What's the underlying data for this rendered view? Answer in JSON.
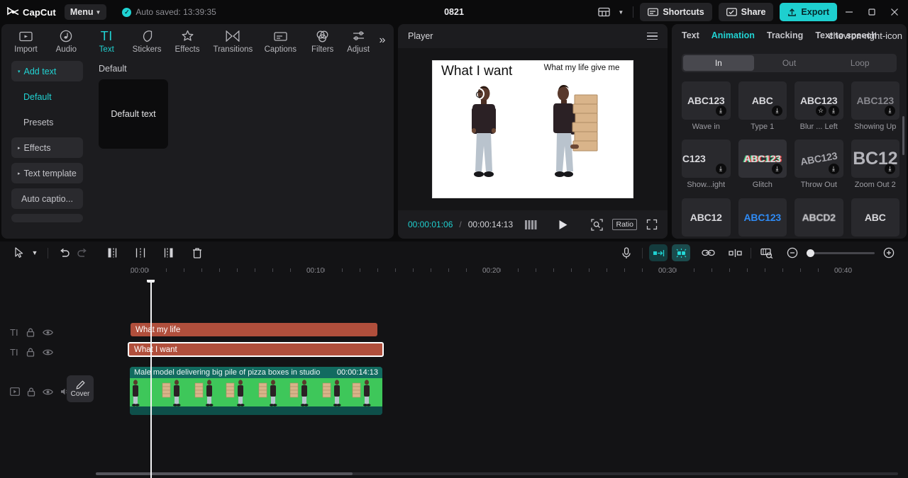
{
  "titlebar": {
    "brand": "CapCut",
    "menu_label": "Menu",
    "autosave_text": "Auto saved: 13:39:35",
    "project_title": "0821",
    "shortcuts_label": "Shortcuts",
    "share_label": "Share",
    "export_label": "Export",
    "accent_color": "#1ecfcf",
    "icons": {
      "layout": "layout-icon",
      "layout_caret": "chevron-down-icon",
      "shortcuts": "keyboard-icon",
      "share": "share-icon",
      "export": "upload-icon",
      "minimize": "minimize-icon",
      "maximize": "maximize-icon",
      "close": "close-icon"
    }
  },
  "left_panel": {
    "tabs": [
      {
        "label": "Import",
        "icon": "media-icon",
        "active": false
      },
      {
        "label": "Audio",
        "icon": "music-note-icon",
        "active": false
      },
      {
        "label": "Text",
        "icon": "text-ti-icon",
        "active": true
      },
      {
        "label": "Stickers",
        "icon": "sticker-icon",
        "active": false
      },
      {
        "label": "Effects",
        "icon": "sparkle-icon",
        "active": false
      },
      {
        "label": "Transitions",
        "icon": "transition-icon",
        "active": false
      },
      {
        "label": "Captions",
        "icon": "caption-icon",
        "active": false
      },
      {
        "label": "Filters",
        "icon": "filters-icon",
        "active": false
      },
      {
        "label": "Adjust",
        "icon": "adjust-icon",
        "active": false
      }
    ],
    "more_tabs": "»",
    "nav": [
      {
        "label": "Add text",
        "style": "box-accent",
        "expand": "▾"
      },
      {
        "label": "Default",
        "style": "sub-accent",
        "expand": ""
      },
      {
        "label": "Presets",
        "style": "sub",
        "expand": ""
      },
      {
        "label": "Effects",
        "style": "box",
        "expand": "▸"
      },
      {
        "label": "Text template",
        "style": "box",
        "expand": "▸"
      },
      {
        "label": "Auto captio...",
        "style": "box",
        "expand": ""
      }
    ],
    "section_label": "Default",
    "card_label": "Default text"
  },
  "player": {
    "title": "Player",
    "menu_icon": "hamburger-icon",
    "current_time": "00:00:01:06",
    "time_separator": "/",
    "total_time": "00:00:14:13",
    "ratio_label": "Ratio",
    "icons": {
      "frames": "frames-icon",
      "play": "play-icon",
      "zoom_fit": "zoom-fit-icon",
      "fullscreen": "fullscreen-icon"
    },
    "canvas": {
      "left_text": "What I want",
      "right_text": "What my life give me"
    }
  },
  "right_panel": {
    "tabs": [
      {
        "label": "Text",
        "active": false
      },
      {
        "label": "Animation",
        "active": true
      },
      {
        "label": "Tracking",
        "active": false
      },
      {
        "label": "Text to speech",
        "active": false
      }
    ],
    "more_icon": "chevron-right-icon",
    "segments": [
      {
        "label": "In",
        "active": true
      },
      {
        "label": "Out",
        "active": false
      },
      {
        "label": "Loop",
        "active": false
      }
    ],
    "animations": [
      {
        "name": "Wave in",
        "preview": "ABC123",
        "download": true,
        "star": false
      },
      {
        "name": "Type 1",
        "preview": "ABC",
        "download": true,
        "star": false
      },
      {
        "name": "Blur ... Left",
        "preview": "ABC123",
        "download": true,
        "star": true
      },
      {
        "name": "Showing Up",
        "preview": "ABC123",
        "download": true,
        "star": false
      },
      {
        "name": "Show...ight",
        "preview": "C123",
        "download": true,
        "star": false
      },
      {
        "name": "Glitch",
        "preview": "ABC123",
        "download": true,
        "star": false
      },
      {
        "name": "Throw Out",
        "preview": "ABC123",
        "download": true,
        "star": false
      },
      {
        "name": "Zoom Out 2",
        "preview": "BC12",
        "download": true,
        "star": false
      }
    ],
    "partial_row": [
      {
        "preview": "ABC12"
      },
      {
        "preview": "ABC123"
      },
      {
        "preview": "ABCD2"
      },
      {
        "preview": "ABC"
      }
    ]
  },
  "timeline": {
    "tools_left": [
      {
        "icon": "cursor-icon",
        "name": "select-tool",
        "dim": false
      },
      {
        "icon": "chevron-down-icon",
        "name": "select-tool-dropdown",
        "dim": false
      },
      {
        "icon": "undo-icon",
        "name": "undo",
        "dim": false
      },
      {
        "icon": "redo-icon",
        "name": "redo",
        "dim": true
      },
      {
        "icon": "trim-left-icon",
        "name": "trim-start",
        "dim": false
      },
      {
        "icon": "split-icon",
        "name": "split",
        "dim": false
      },
      {
        "icon": "trim-right-icon",
        "name": "trim-end",
        "dim": false
      },
      {
        "icon": "delete-icon",
        "name": "delete",
        "dim": false
      }
    ],
    "tools_right": [
      {
        "icon": "microphone-icon",
        "name": "record-voiceover",
        "state": "normal"
      },
      {
        "icon": "snap-clip-icon",
        "name": "snap-to-clip",
        "state": "highlight"
      },
      {
        "icon": "magnet-icon",
        "name": "magnet-snap",
        "state": "highlight2"
      },
      {
        "icon": "link-icon",
        "name": "link-clips",
        "state": "normal"
      },
      {
        "icon": "split-view-icon",
        "name": "split-view",
        "state": "normal"
      },
      {
        "icon": "preview-icon",
        "name": "preview-thumbnails",
        "state": "normal"
      },
      {
        "icon": "zoom-out-icon",
        "name": "zoom-out",
        "state": "normal"
      },
      {
        "icon": "zoom-in-icon",
        "name": "zoom-in",
        "state": "normal"
      }
    ],
    "ruler_ticks": [
      "00:00",
      "00:10",
      "00:20",
      "00:30",
      "00:40"
    ],
    "text_tracks": [
      {
        "label": "What my life",
        "selected": false,
        "icons": [
          "text-ti-icon",
          "lock-icon",
          "eye-icon"
        ]
      },
      {
        "label": "What I want",
        "selected": true,
        "icons": [
          "text-ti-icon",
          "lock-icon",
          "eye-icon"
        ]
      }
    ],
    "video_track": {
      "icons": [
        "video-icon",
        "lock-icon",
        "eye-icon",
        "volume-icon",
        "more-icon"
      ],
      "cover_label": "Cover",
      "clip_label": "Male model delivering big pile of pizza boxes in studio",
      "clip_duration": "00:00:14:13"
    }
  }
}
